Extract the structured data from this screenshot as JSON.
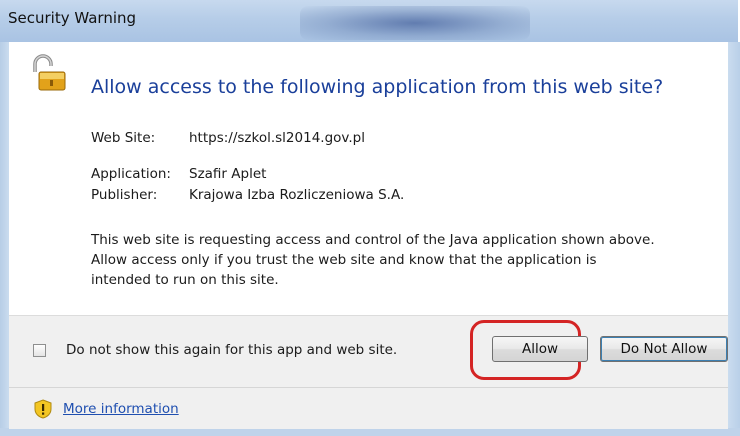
{
  "window": {
    "title": "Security Warning"
  },
  "dialog": {
    "headline": "Allow access to the following application from this web site?",
    "website_label": "Web Site:",
    "website_value": "https://szkol.sl2014.gov.pl",
    "application_label": "Application:",
    "application_value": "Szafir Aplet",
    "publisher_label": "Publisher:",
    "publisher_value": "Krajowa Izba Rozliczeniowa S.A.",
    "message_lines": [
      "This web site is requesting access and control of the Java application shown above.",
      "Allow access only if you trust the web site and know that the application is",
      "intended to run on this site."
    ]
  },
  "footer": {
    "checkbox_label": "Do not show this again for this app and web site.",
    "checkbox_checked": false,
    "allow_label": "Allow",
    "deny_label": "Do Not Allow",
    "more_info_label": "More information"
  },
  "icons": {
    "lock": "padlock-open-icon",
    "warning": "warning-shield-icon"
  },
  "colors": {
    "headline": "#1a3f9a",
    "link": "#1f4fb0",
    "highlight_ring": "#d42424",
    "titlebar": "#b6cde8"
  }
}
